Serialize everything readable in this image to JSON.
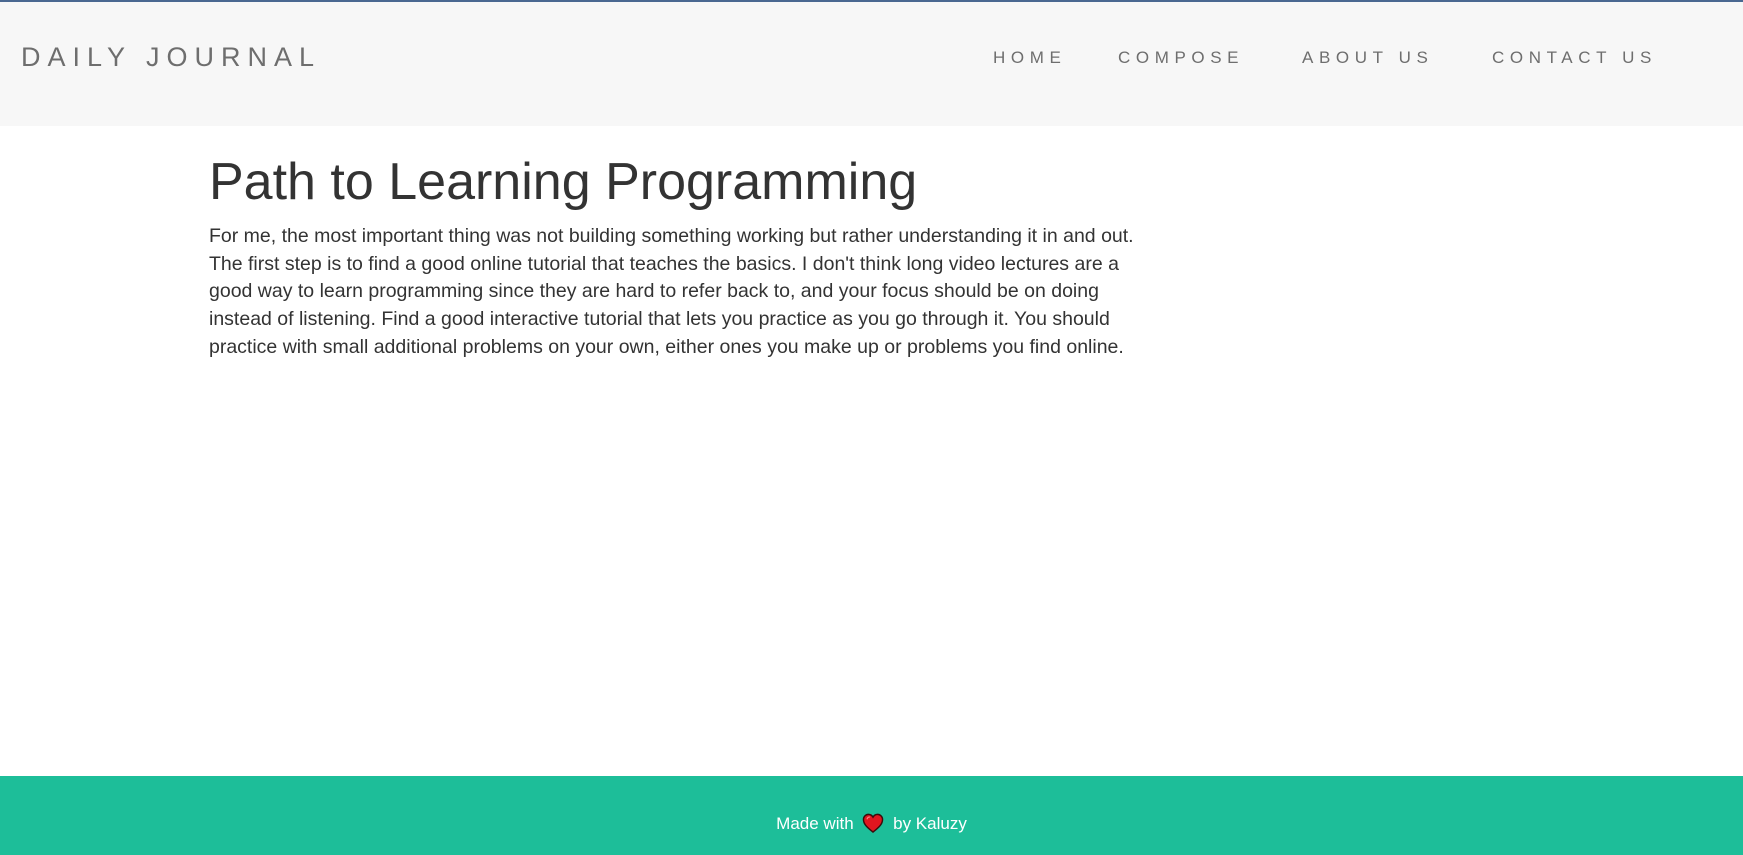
{
  "header": {
    "brand": "DAILY JOURNAL",
    "nav": {
      "home": "HOME",
      "compose": "COMPOSE",
      "about": "ABOUT US",
      "contact": "CONTACT US"
    }
  },
  "post": {
    "title": "Path to Learning Programming",
    "body": "For me, the most important thing was not building something working but rather understanding it in and out. The first step is to find a good online tutorial that teaches the basics. I don't think long video lectures are a good way to learn programming since they are hard to refer back to, and your focus should be on doing instead of listening. Find a good interactive tutorial that lets you practice as you go through it. You should practice with small additional problems on your own, either ones you make up or problems you find online."
  },
  "footer": {
    "made_with": "Made with",
    "by": "by Kaluzy",
    "icon": "heart-icon"
  },
  "colors": {
    "navbar_bg": "#f7f7f7",
    "footer_bg": "#1dbe99",
    "heart": "#e0161f",
    "text": "#333333",
    "nav_text": "#6e6e6e"
  }
}
